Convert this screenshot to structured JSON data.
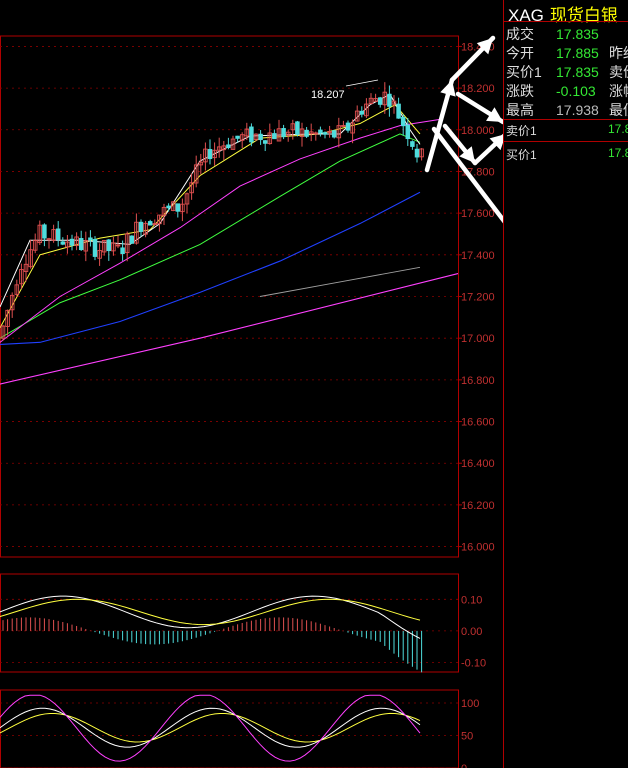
{
  "panel": {
    "code": "XAG",
    "name": "现货白银",
    "rows": [
      {
        "label": "成交",
        "value": "17.835",
        "color": "#34e834",
        "label2": ""
      },
      {
        "label": "今开",
        "value": "17.885",
        "color": "#34e834",
        "label2": "昨结"
      },
      {
        "label": "买价1",
        "value": "17.835",
        "color": "#34e834",
        "label2": "卖价"
      },
      {
        "label": "涨跌",
        "value": "-0.103",
        "color": "#34e834",
        "label2": "涨幅"
      },
      {
        "label": "最高",
        "value": "17.938",
        "color": "#bbbbbb",
        "label2": "最低"
      }
    ],
    "ask_label": "卖价1",
    "ask_value": "17.8",
    "bid_label": "买价1",
    "bid_value": "17.8"
  },
  "chart_data": [
    {
      "type": "candlestick",
      "ylim": [
        15.95,
        18.45
      ],
      "yticks": [
        "18.400",
        "18.200",
        "18.000",
        "17.800",
        "17.600",
        "17.400",
        "17.200",
        "17.000",
        "16.800",
        "16.600",
        "16.400",
        "16.200",
        "16.000"
      ],
      "annotation": "18.207",
      "colors": {
        "up": "#e05050",
        "down": "#4fdcdc",
        "ma5": "#ffffff",
        "ma10": "#ffff40",
        "ma20": "#ff40ff",
        "ma30": "#40ff40",
        "ma60": "#2040ff",
        "ma120": "#a0a0a0",
        "ma250": "#ff40ff"
      },
      "series_ma5_end": 17.93,
      "series_ma10_end": 17.98,
      "series_ma20_end": 18.05,
      "series_ma30_end": 17.94,
      "series_ma60_end": 17.7,
      "series_ma120_end": 17.34,
      "series_ma250_end": 17.31
    },
    {
      "type": "macd",
      "ylim": [
        -0.13,
        0.18
      ],
      "yticks": [
        "0.10",
        "0.00",
        "-0.10"
      ]
    },
    {
      "type": "kdj",
      "ylim": [
        0,
        120
      ],
      "yticks": [
        "100",
        "50",
        "0"
      ]
    }
  ]
}
